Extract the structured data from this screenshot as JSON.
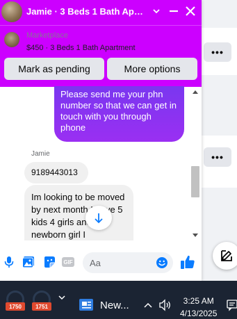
{
  "chat": {
    "title": "Jamie · 3 Beds 1 Bath Apar...",
    "marketplace_label": "Marketplace",
    "listing": "$450 · 3 Beds 1 Bath Apartment",
    "actions": {
      "mark_pending": "Mark as pending",
      "more_options": "More options"
    },
    "messages": {
      "outgoing_text": "Please send me your phn number so that we can get in touch with you through phone",
      "sender_name": "Jamie",
      "incoming_1": "9189443013",
      "incoming_2": "Im looking to be moved by next month I have 5 kids 4 girls and a newborn girl I"
    },
    "composer_placeholder": "Aa",
    "gif_label": "GIF"
  },
  "colors": {
    "header": "#cc00ff",
    "bubble_out": "#8a2be2",
    "accent_blue": "#0a7cff"
  },
  "taskbar": {
    "app_badge_1": "1750",
    "app_badge_2": "1751",
    "news_label": "New...",
    "time": "3:25 AM",
    "date": "4/13/2025"
  },
  "icons": [
    "chevron-down-icon",
    "minimize-icon",
    "close-icon",
    "mic-icon",
    "photo-icon",
    "sticker-icon",
    "gif-icon",
    "emoji-icon",
    "like-icon",
    "arrow-down-icon",
    "compose-icon",
    "volume-icon",
    "notification-icon"
  ]
}
